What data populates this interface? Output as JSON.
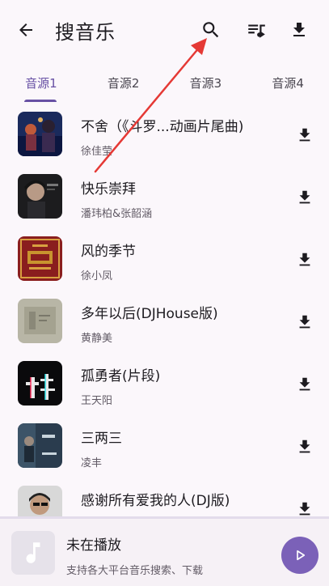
{
  "appbar": {
    "title": "搜音乐",
    "icons": [
      "back-arrow-icon",
      "search-icon",
      "queue-music-icon",
      "download-icon"
    ]
  },
  "tabs": [
    {
      "label": "音源1",
      "active": true
    },
    {
      "label": "音源2",
      "active": false
    },
    {
      "label": "音源3",
      "active": false
    },
    {
      "label": "音源4",
      "active": false
    }
  ],
  "songs": [
    {
      "title": "不舍（《斗罗...动画片尾曲)",
      "artist": "徐佳莹"
    },
    {
      "title": "快乐崇拜",
      "artist": "潘玮柏&张韶涵"
    },
    {
      "title": "风的季节",
      "artist": "徐小凤"
    },
    {
      "title": "多年以后(DJHouse版)",
      "artist": "黄静美"
    },
    {
      "title": "孤勇者(片段)",
      "artist": "王天阳"
    },
    {
      "title": "三两三",
      "artist": "凌丰"
    },
    {
      "title": "感谢所有爱我的人(DJ版)",
      "artist": ""
    }
  ],
  "player": {
    "title": "未在播放",
    "subtitle": "支持各大平台音乐搜索、下载"
  },
  "colors": {
    "accent": "#6750a4",
    "play_button": "#7b61b8",
    "annotation_arrow": "#e53935",
    "background": "#fbf7fb"
  }
}
